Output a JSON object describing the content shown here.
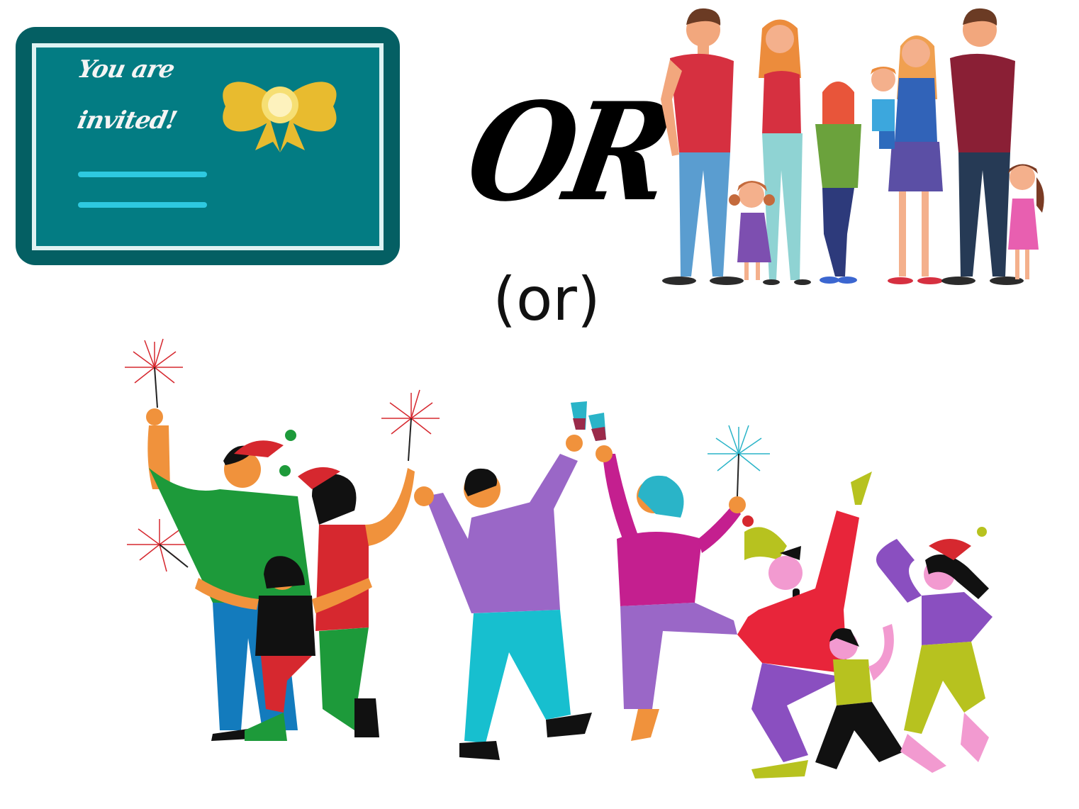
{
  "invitation_card": {
    "line1": "You are",
    "line2": "invited!",
    "color_body": "#037c83",
    "color_frame": "#045f63",
    "color_bow": "#e8bb2f",
    "color_lines": "#2ec9e0"
  },
  "separator": {
    "script_text": "OR",
    "plain_text": "(or)"
  },
  "icons": {
    "card": "invitation-card-icon",
    "family": "family-group-illustration",
    "party": "party-crowd-illustration"
  }
}
